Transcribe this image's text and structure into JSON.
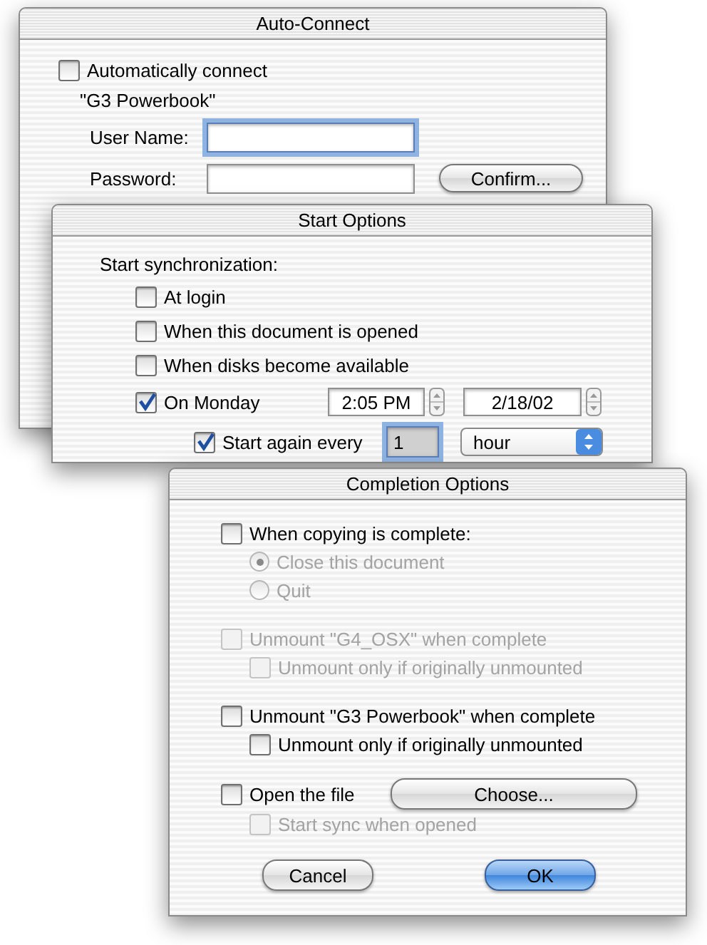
{
  "auto_connect": {
    "title": "Auto-Connect",
    "connect": {
      "label": "Automatically connect",
      "checked": false
    },
    "volume": "\"G3 Powerbook\"",
    "fields": [
      {
        "label": "User Name:",
        "focused": true
      },
      {
        "label": "Password:",
        "focused": false
      }
    ],
    "confirm_button": "Confirm..."
  },
  "start_options": {
    "title": "Start Options",
    "heading": "Start synchronization:",
    "options": [
      {
        "kind": "checkbox",
        "label": "At login",
        "checked": false
      },
      {
        "kind": "checkbox",
        "label": "When this document is opened",
        "checked": false
      },
      {
        "kind": "checkbox",
        "label": "When disks become available",
        "checked": false
      },
      {
        "kind": "schedule",
        "label": "On Monday",
        "checked": true,
        "time": "2:05 PM",
        "date": "2/18/02"
      }
    ],
    "repeat": {
      "label": "Start again every",
      "checked": true,
      "interval": "1",
      "focused": true,
      "unit": "hour"
    }
  },
  "completion_options": {
    "title": "Completion Options",
    "groups": [
      {
        "label": "When copying is complete:",
        "checked": false,
        "disabled": false,
        "radios": [
          {
            "label": "Close this document",
            "selected": true,
            "disabled": true
          },
          {
            "label": "Quit",
            "selected": false,
            "disabled": true
          }
        ]
      },
      {
        "label": "Unmount \"G4_OSX\" when complete",
        "checked": false,
        "disabled": true,
        "children": [
          {
            "label": "Unmount only if originally unmounted",
            "checked": false,
            "disabled": true
          }
        ]
      },
      {
        "label": "Unmount \"G3 Powerbook\" when complete",
        "checked": false,
        "disabled": false,
        "children": [
          {
            "label": "Unmount only if originally unmounted",
            "checked": false,
            "disabled": false
          }
        ]
      },
      {
        "label": "Open the file",
        "checked": false,
        "disabled": false,
        "button": "Choose...",
        "children": [
          {
            "label": "Start sync when opened",
            "checked": false,
            "disabled": true
          }
        ]
      }
    ],
    "buttons": [
      {
        "label": "Cancel",
        "default": false
      },
      {
        "label": "OK",
        "default": true
      }
    ]
  }
}
